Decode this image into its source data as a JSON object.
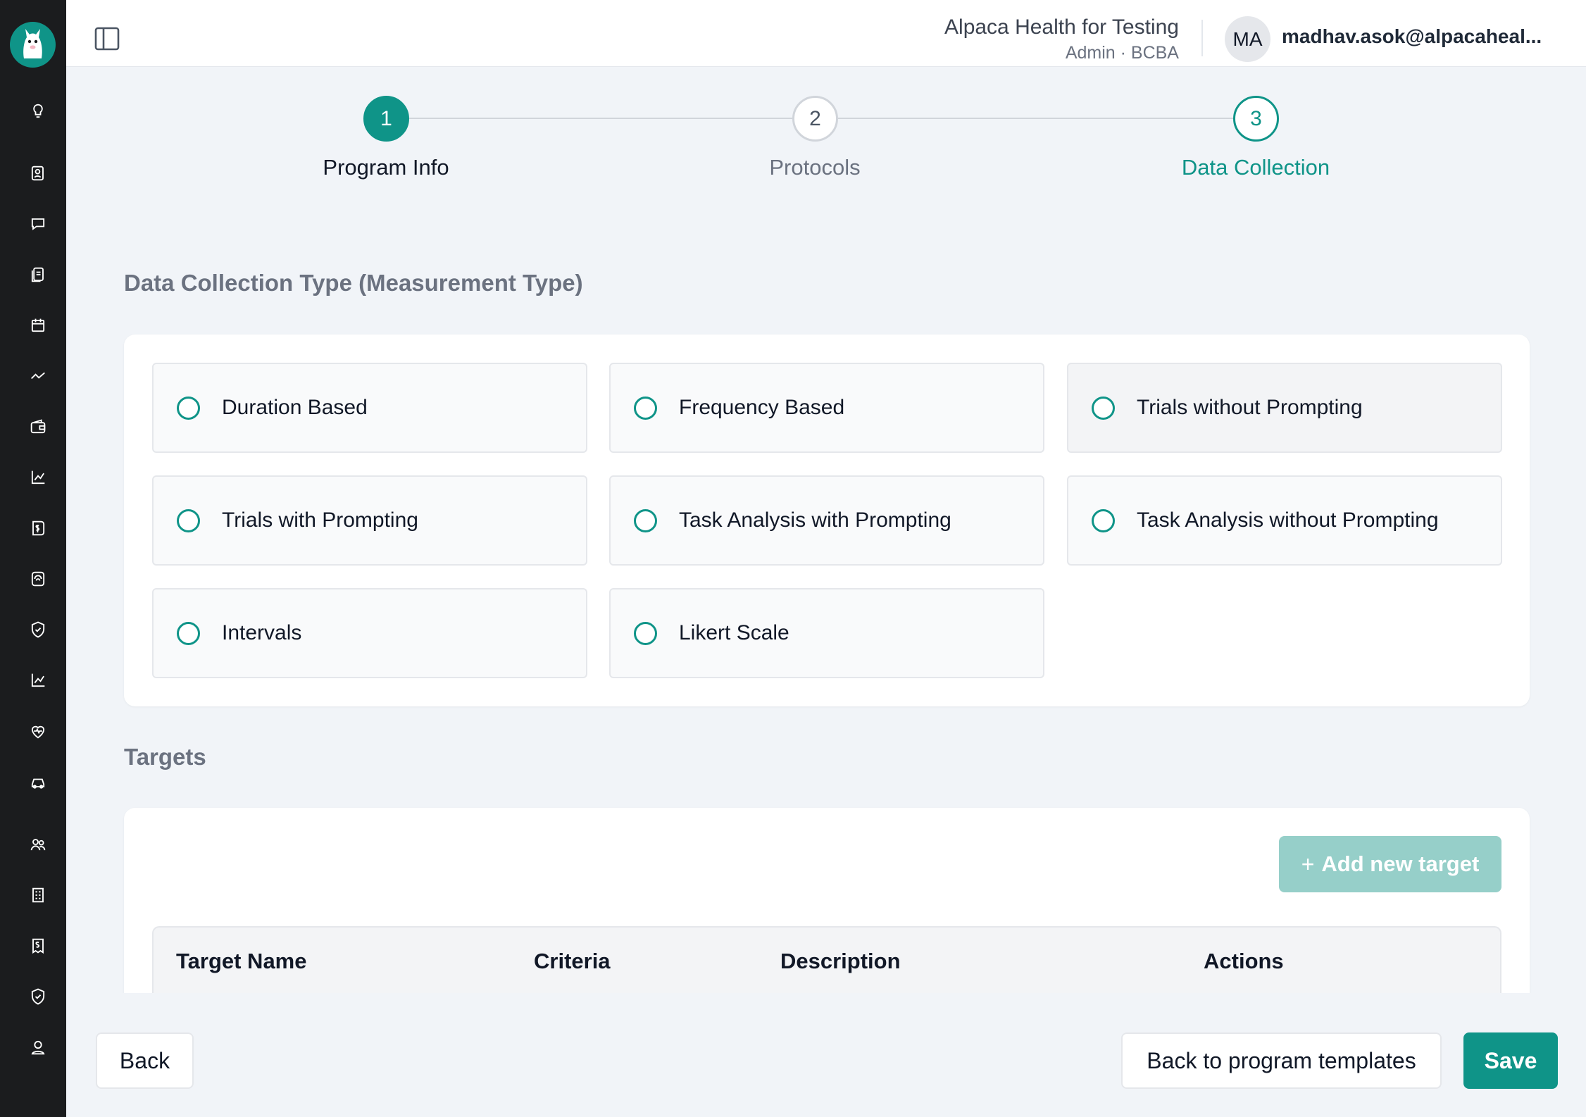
{
  "sidebar": {
    "logo": "alpaca-logo",
    "items": [
      {
        "icon": "lightbulb-icon"
      },
      {
        "icon": "clients-icon"
      },
      {
        "icon": "messages-icon"
      },
      {
        "icon": "notes-icon"
      },
      {
        "icon": "calendar-icon"
      },
      {
        "icon": "trend-icon"
      },
      {
        "icon": "wallet-icon"
      },
      {
        "icon": "chart-icon"
      },
      {
        "icon": "billing-icon"
      },
      {
        "icon": "programs-icon"
      },
      {
        "icon": "shield-check-icon"
      },
      {
        "icon": "analytics-icon"
      },
      {
        "icon": "health-icon"
      },
      {
        "icon": "vehicle-icon"
      },
      {
        "icon": "team-icon"
      },
      {
        "icon": "organization-icon"
      },
      {
        "icon": "invoice-icon"
      },
      {
        "icon": "compliance-icon"
      },
      {
        "icon": "profile-icon"
      }
    ]
  },
  "header": {
    "org_name": "Alpaca Health for Testing",
    "org_role": "Admin · BCBA",
    "avatar_initials": "MA",
    "user_email": "madhav.asok@alpacaheal..."
  },
  "stepper": {
    "steps": [
      {
        "number": "1",
        "label": "Program Info",
        "state": "done"
      },
      {
        "number": "2",
        "label": "Protocols",
        "state": "pending"
      },
      {
        "number": "3",
        "label": "Data Collection",
        "state": "current"
      }
    ]
  },
  "data_collection": {
    "title": "Data Collection Type (Measurement Type)",
    "options": [
      {
        "label": "Duration Based",
        "selected": false
      },
      {
        "label": "Frequency Based",
        "selected": false
      },
      {
        "label": "Trials without Prompting",
        "selected": false
      },
      {
        "label": "Trials with Prompting",
        "selected": false
      },
      {
        "label": "Task Analysis with Prompting",
        "selected": false
      },
      {
        "label": "Task Analysis without Prompting",
        "selected": false
      },
      {
        "label": "Intervals",
        "selected": false
      },
      {
        "label": "Likert Scale",
        "selected": false
      }
    ]
  },
  "targets": {
    "title": "Targets",
    "add_label": "Add new target",
    "columns": [
      "Target Name",
      "Criteria",
      "Description",
      "Actions"
    ]
  },
  "footer": {
    "back_label": "Back",
    "back_templates_label": "Back to program templates",
    "save_label": "Save"
  },
  "colors": {
    "accent": "#0f9488",
    "sidebar": "#1b1c1e",
    "page_bg": "#f1f4f8"
  }
}
